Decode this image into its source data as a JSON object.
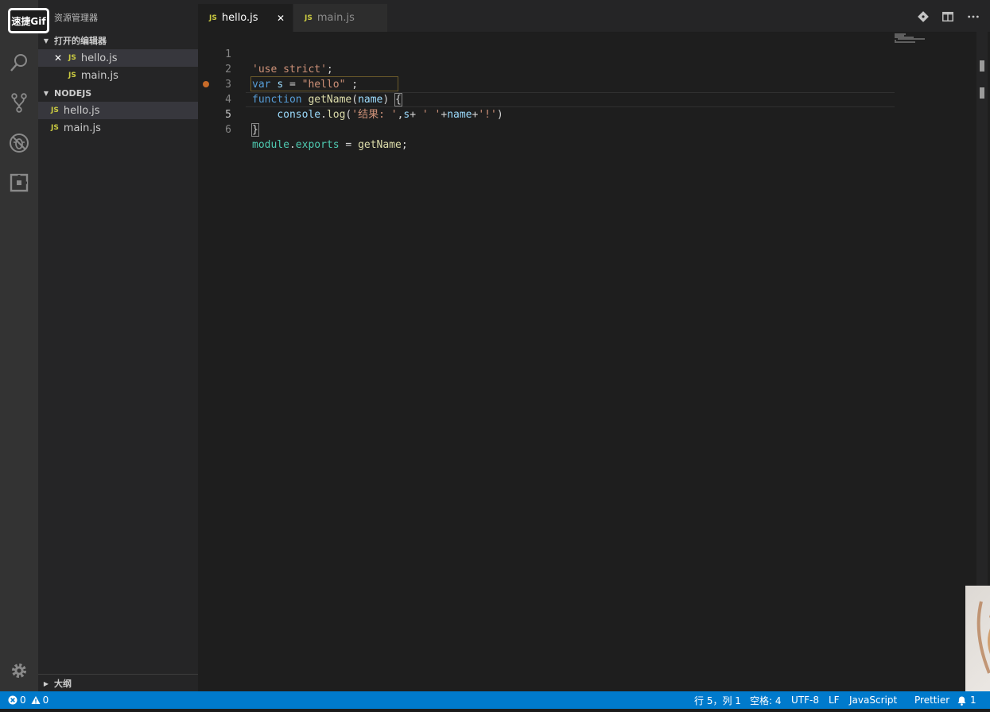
{
  "watermark": "速捷Gif",
  "sidebar": {
    "title": "资源管理器",
    "open_editors_header": "打开的编辑器",
    "open_editors": [
      {
        "name": "hello.js",
        "badge": "JS",
        "close": "✕"
      },
      {
        "name": "main.js",
        "badge": "JS"
      }
    ],
    "folder_header": "NODEJS",
    "files": [
      {
        "name": "hello.js",
        "badge": "JS"
      },
      {
        "name": "main.js",
        "badge": "JS"
      }
    ],
    "outline_header": "大纲"
  },
  "tabs": [
    {
      "label": "hello.js",
      "badge": "JS",
      "close": "✕"
    },
    {
      "label": "main.js",
      "badge": "JS"
    }
  ],
  "editor": {
    "line_numbers": [
      "1",
      "2",
      "3",
      "4",
      "5",
      "6"
    ],
    "lines": {
      "l1_str": "'use strict'",
      "l1_semi": ";",
      "l2_kw": "var",
      "l2_var": "s",
      "l2_eq": " = ",
      "l2_str": "\"hello\"",
      "l2_semi": " ;",
      "l3_kw": "function",
      "l3_fn": "getName",
      "l3_open": "(",
      "l3_param": "name",
      "l3_close": ")",
      "l3_brace": "{",
      "l4_obj": "console",
      "l4_dot": ".",
      "l4_fn": "log",
      "l4_open": "(",
      "l4_str1": "'结果: '",
      "l4_comma": ",",
      "l4_s": "s",
      "l4_plus1": "+ ",
      "l4_str2": "' '",
      "l4_plus2": "+",
      "l4_name": "name",
      "l4_plus3": "+",
      "l4_str3": "'!'",
      "l4_close": ")",
      "l5_brace": "}",
      "l6_mod": "module",
      "l6_dot": ".",
      "l6_exports": "exports",
      "l6_eq": " = ",
      "l6_fn": "getName",
      "l6_semi": ";"
    }
  },
  "statusbar": {
    "errors": "0",
    "warnings": "0",
    "position": "行 5，列 1",
    "indent": "空格: 4",
    "encoding": "UTF-8",
    "eol": "LF",
    "language": "JavaScript",
    "formatter": "Prettier",
    "notifications": "1"
  },
  "colors": {
    "statusbar": "#007acc",
    "activity_bar": "#333333",
    "sidebar": "#252526",
    "editor": "#1e1e1e",
    "js_badge": "#cbcb41",
    "breakpoint": "#c76b29"
  },
  "icons": [
    "files-icon",
    "search-icon",
    "source-control-icon",
    "debug-icon",
    "extensions-icon",
    "settings-gear-icon",
    "git-compare-icon",
    "split-editor-icon",
    "more-actions-icon",
    "error-icon",
    "warning-icon",
    "bell-icon"
  ]
}
